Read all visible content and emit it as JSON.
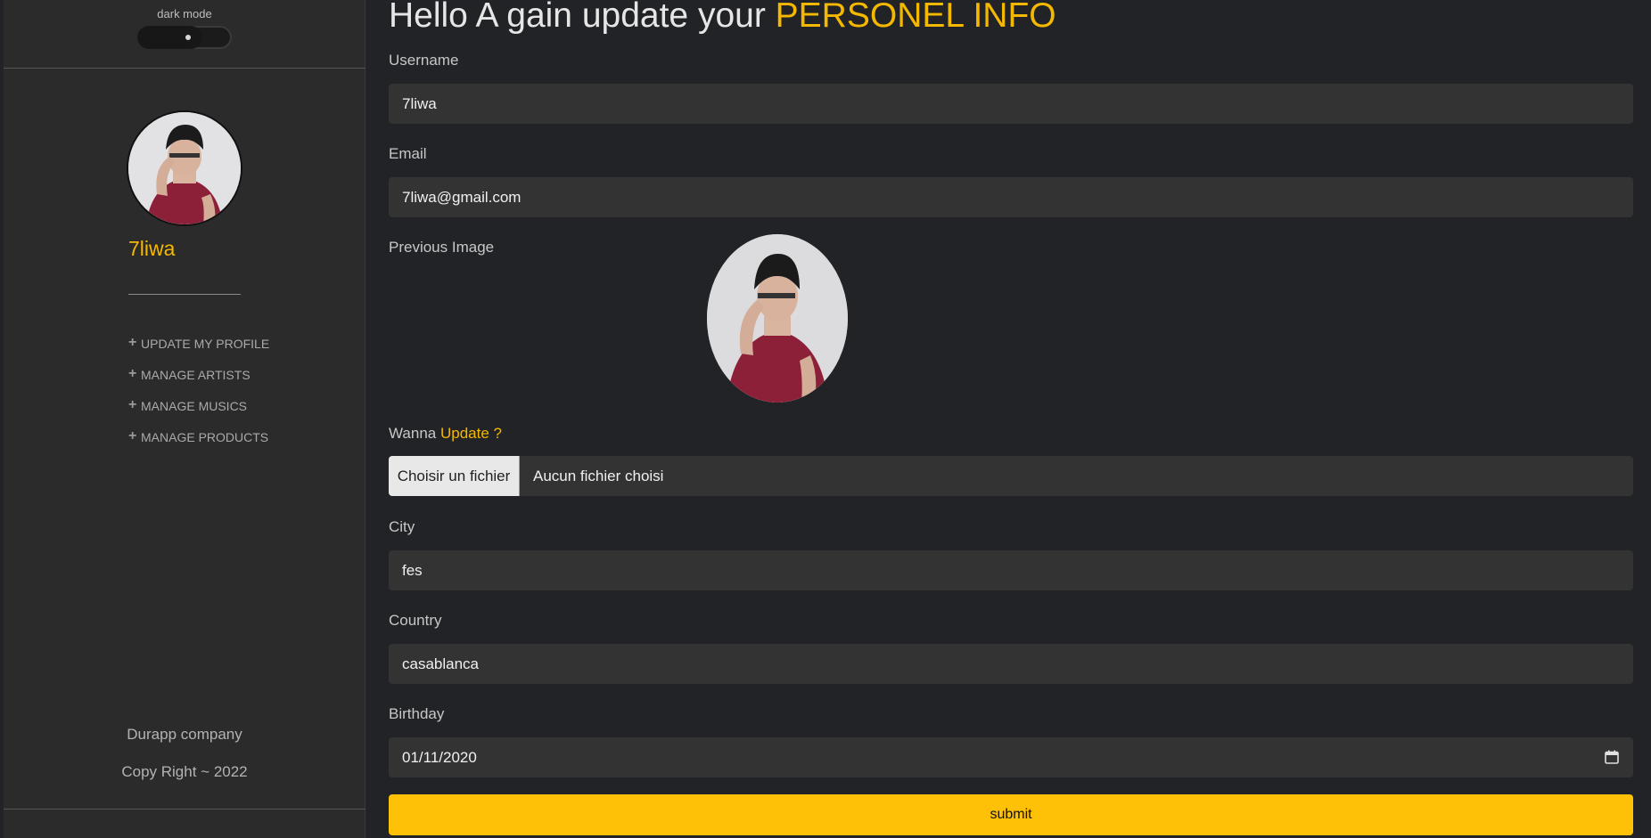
{
  "sidebar": {
    "dark_mode_label": "dark mode",
    "user_name": "7liwa",
    "menu": [
      {
        "label": "UPDATE MY PROFILE",
        "icon": "plus-icon"
      },
      {
        "label": "MANAGE ARTISTS",
        "icon": "plus-icon"
      },
      {
        "label": "MANAGE MUSICS",
        "icon": "plus-icon"
      },
      {
        "label": "MANAGE PRODUCTS",
        "icon": "plus-icon"
      }
    ],
    "footer_company": "Durapp company",
    "footer_copyright": "Copy Right ~ 2022"
  },
  "main": {
    "title_prefix": "Hello A gain update your ",
    "title_accent": "PERSONEL INFO",
    "username_label": "Username",
    "username_value": "7liwa",
    "email_label": "Email",
    "email_value": "7liwa@gmail.com",
    "previous_image_label": "Previous Image",
    "wanna_prefix": "Wanna ",
    "wanna_accent": "Update ?",
    "file_button_label": "Choisir un fichier",
    "file_status": "Aucun fichier choisi",
    "city_label": "City",
    "city_value": "fes",
    "country_label": "Country",
    "country_value": "casablanca",
    "birthday_label": "Birthday",
    "birthday_value": "01/11/2020",
    "submit_label": "submit"
  },
  "colors": {
    "accent": "#ffc107",
    "page_bg": "#222326",
    "sidebar_bg": "#2b2b2b",
    "field_bg": "#333333"
  }
}
